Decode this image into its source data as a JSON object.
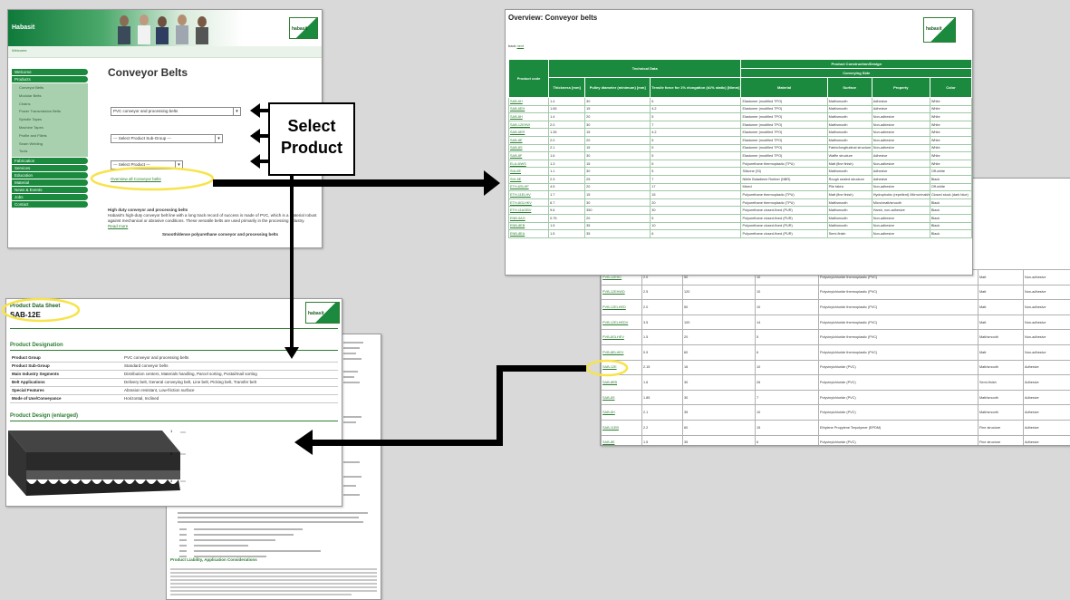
{
  "callout": {
    "line1": "Select",
    "line2": "Product"
  },
  "site": {
    "brand": "Habasit",
    "breadcrumb": "Welcome",
    "title": "Conveyor Belts",
    "select1": "PVC conveyor and processing belts",
    "select2": "--- Select Product Sub-Group ---",
    "select3": "--- Select Product ---",
    "overview_link": "Overview all Conveyor belts",
    "intro_title": "High duty conveyor and processing belts",
    "intro_text": "Habasit's high-duty conveyor belt line with a long track record of success is made of PVC, which is a material robust against mechanical or abrasive conditions. These versatile belts are used primarily in the processing industry.",
    "intro_more": "Read more",
    "footer_text": "Smooth/dense polyurethane conveyor and processing belts",
    "nav": {
      "top": [
        "Welcome",
        "Products"
      ],
      "sub": [
        "Conveyor Belts",
        "Modular Belts",
        "Chains",
        "Power Transmission Belts",
        "Spindle Tapes",
        "Machine Tapes",
        "Profile and Fillets",
        "Seam Welding",
        "Tools"
      ],
      "bottom": [
        "Fabrication",
        "Services",
        "Education",
        "Material",
        "News & Events",
        "Jobs",
        "Contact"
      ]
    }
  },
  "overview": {
    "title": "Overview: Conveyor belts",
    "back": "back",
    "back_link": "next",
    "logo": "habasit",
    "headers": {
      "product_code": "Product code",
      "technical_data": "Technical Data",
      "product_construction": "Product Construction/Design",
      "conveying_side": "Conveying Side",
      "thickness": "Thickness [mm]",
      "pulley": "Pulley diameter (minimum) [mm]",
      "tensile": "Tensile force for 1% elongation (k1% static) [N/mm]",
      "material": "Material",
      "surface": "Surface",
      "property": "Property",
      "color": "Color"
    },
    "rows": [
      [
        "SAB-6H",
        "1.4",
        "30",
        "6",
        "Elastomer (modified TPO)",
        "Matt/smooth",
        "Adhesive",
        "White"
      ],
      [
        "SAB-6EH",
        "1.65",
        "15",
        "4.2",
        "Elastomer (modified TPO)",
        "Matt/smooth",
        "Adhesive",
        "White"
      ],
      [
        "SAB-8H",
        "1.4",
        "20",
        "5",
        "Elastomer (modified TPO)",
        "Matt/smooth",
        "Non-adhesive",
        "White"
      ],
      [
        "SAB-12EHW",
        "2.0",
        "30",
        "7",
        "Elastomer (modified TPO)",
        "Matt/smooth",
        "Non-adhesive",
        "White"
      ],
      [
        "SAB-6ER",
        "1.35",
        "15",
        "4.2",
        "Elastomer (modified TPO)",
        "Matt/smooth",
        "Non-adhesive",
        "White"
      ],
      [
        "SAB-8E",
        "2.0",
        "20",
        "5",
        "Elastomer (modified TPO)",
        "Matt/smooth",
        "Non-adhesive",
        "White"
      ],
      [
        "SAB-8S",
        "2.1",
        "15",
        "5",
        "Elastomer (modified TPO)",
        "Fabric/longitudinal structure",
        "Non-adhesive",
        "White"
      ],
      [
        "SAB-8F",
        "1.6",
        "30",
        "5",
        "Elastomer (modified TPO)",
        "Waffle structure",
        "Adhesive",
        "White"
      ],
      [
        "ELA-6IWS",
        "1.3",
        "15",
        "5",
        "Polyurethane thermoplastic (TPU)",
        "Matt (fine finish)",
        "Non-adhesive",
        "White"
      ],
      [
        "SIA-6E",
        "1.1",
        "30",
        "5",
        "Silicone (SI)",
        "Matt/smooth",
        "Adhesive",
        "Off-white"
      ],
      [
        "SIH-8E",
        "2.3",
        "25",
        "7",
        "Nitrile Butadiene Rubber (NBR)",
        "Rough sealed structure",
        "Adhesive",
        "Black"
      ],
      [
        "ETH-6SLHF",
        "4.5",
        "20",
        "17",
        "Mixed",
        "Pile fabric",
        "Non-adhesive",
        "Off-white"
      ],
      [
        "ETH-11ELHV",
        "1.7",
        "15",
        "15",
        "Polyurethane thermoplastic (TPU)",
        "Matt (fine finish)",
        "Hydrophobic (repellent) /Mirror/matt/smooth",
        "Closed stuck (dark blue)"
      ],
      [
        "ETH-8GLHKV",
        "6.7",
        "30",
        "20",
        "Polyurethane thermoplastic (TPU)",
        "Matt/smooth",
        "Micro/matt/smooth",
        "Black"
      ],
      [
        "ETH-11AGBV",
        "9.6",
        "350",
        "30",
        "Polyurethane closed-fixed (PUR)",
        "Matt/smooth",
        "Harsh, non-adhesive",
        "Black"
      ],
      [
        "ENB-5AG",
        "0.75",
        "20",
        "5",
        "Polyurethane closed-fixed (PUR)",
        "Matt/smooth",
        "Non-adhesive",
        "Black"
      ],
      [
        "ENB-8EB",
        "1.5",
        "35",
        "10",
        "Polyurethane closed-fixed (PUR)",
        "Matt/smooth",
        "Non-adhesive",
        "Black"
      ],
      [
        "ENB-8EA",
        "1.5",
        "35",
        "6",
        "Polyurethane closed-fixed (PUR)",
        "Semi-finish",
        "Non-adhesive",
        "Black"
      ]
    ]
  },
  "right_table": {
    "rows": [
      [
        "PVB-12EHC",
        "2.0",
        "50",
        "10",
        "Polyvinylchloride thermoplastic (PVC)",
        "Matt",
        "Non-adhesive"
      ],
      [
        "PVB-12EHWD",
        "2.5",
        "120",
        "10",
        "Polyvinylchloride thermoplastic (PVC)",
        "Matt",
        "Non-adhesive"
      ],
      [
        "PVB-12ELHED",
        "2.0",
        "50",
        "10",
        "Polyvinylchloride thermoplastic (PVC)",
        "Matt",
        "Non-adhesive"
      ],
      [
        "PVB-12ELHEDV",
        "3.5",
        "100",
        "14",
        "Polyvinylchloride thermoplastic (PVC)",
        "Matt",
        "Non-adhesive"
      ],
      [
        "PVB-8GLHEV",
        "1.5",
        "20",
        "5",
        "Polyvinylchloride thermoplastic (PVC)",
        "Matt/smooth",
        "Non-adhesive"
      ],
      [
        "PVB-8ELHEV",
        "0.9",
        "60",
        "6",
        "Polyvinylchloride thermoplastic (PVC)",
        "Matt",
        "Non-adhesive"
      ],
      [
        "SAB-12E",
        "2.15",
        "16",
        "10",
        "Polyvinylchloride (PVC)",
        "Matt/smooth",
        "Adhesive"
      ],
      [
        "SAB-8EB",
        "1.6",
        "30",
        "26",
        "Polyvinylchloride (PVC)",
        "Semi-finish",
        "Adhesive"
      ],
      [
        "SAB-8S",
        "1.85",
        "30",
        "7",
        "Polyvinylchloride (PVC)",
        "Matt/smooth",
        "Adhesive"
      ],
      [
        "SAB-8H",
        "2.1",
        "35",
        "10",
        "Polyvinylchloride (PVC)",
        "Matt/smooth",
        "Adhesive"
      ],
      [
        "SAB-11EB",
        "2.2",
        "60",
        "15",
        "Ethylene Propylene Terpolymer (EPDM)",
        "Fine structure",
        "Adhesive"
      ],
      [
        "SAB-8E",
        "1.5",
        "35",
        "6",
        "Polyvinylchloride (PVC)",
        "Fine structure",
        "Adhesive"
      ],
      [
        "SAB-8S",
        "2.1",
        "30",
        "6",
        "Polyvinylchloride (PVC)",
        "Structure quadrangular pattern",
        "Adhesive"
      ],
      [
        "SAB-8H",
        "1.7",
        "25",
        "5",
        "Polyvinylchloride (PVC)",
        "Waffle structure",
        "Adhesive"
      ]
    ]
  },
  "datasheet": {
    "title": "Product Data Sheet",
    "code": "SAB-12E",
    "logo": "habasit",
    "designation_heading": "Product Designation",
    "rows": [
      {
        "k": "Product Group",
        "v": "PVC conveyor and processing belts"
      },
      {
        "k": "Product Sub-Group",
        "v": "Standard conveyor belts"
      },
      {
        "k": "Main Industry Segments",
        "v": "Distribution centers, Materials handling, Parcel sorting, Postal/mail sorting"
      },
      {
        "k": "Belt Applications",
        "v": "Delivery belt, General conveying belt, Line belt, Picking belt, Transfer belt"
      },
      {
        "k": "Special Features",
        "v": "Abrasion resistant, Low-friction surface"
      },
      {
        "k": "Mode of Use/Conveyance",
        "v": "Horizontal, Inclined"
      }
    ],
    "design_heading": "Product Design (enlarged)",
    "layer_labels": [
      "1",
      "2",
      "3"
    ],
    "back_heading": "Product Liability, Application Considerations"
  },
  "colors": {
    "green": "#1b8a3e",
    "yellow": "#f7e34a",
    "background": "#d9d9d9"
  }
}
